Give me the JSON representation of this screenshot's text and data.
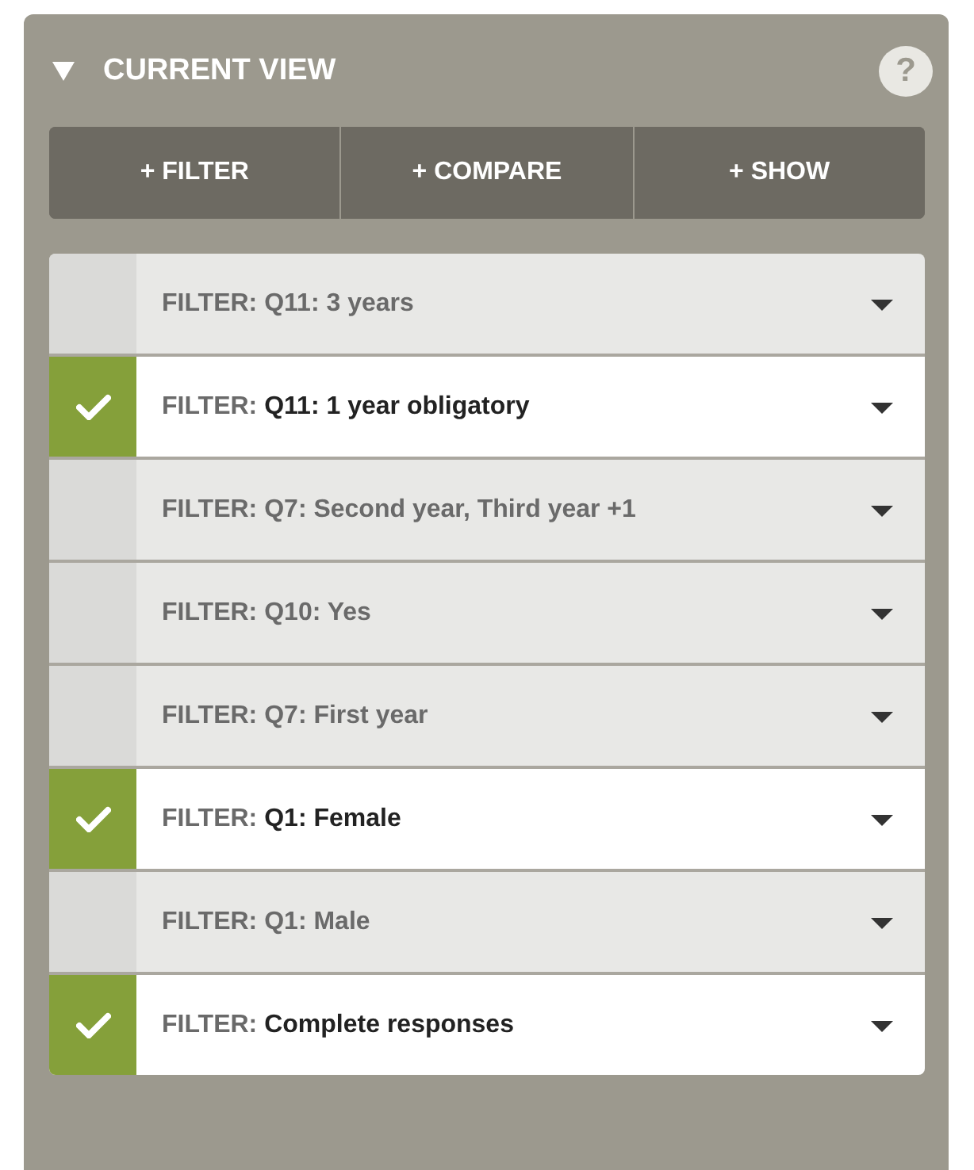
{
  "panel": {
    "title": "CURRENT VIEW",
    "expanded": true,
    "help": "?"
  },
  "actions": [
    "+ FILTER",
    "+ COMPARE",
    "+ SHOW"
  ],
  "filters": [
    {
      "prefix": "FILTER:",
      "text": "Q11: 3 years",
      "checked": false
    },
    {
      "prefix": "FILTER:",
      "text": "Q11: 1 year obligatory",
      "checked": true
    },
    {
      "prefix": "FILTER:",
      "text": "Q7: Second year, Third year +1",
      "checked": false
    },
    {
      "prefix": "FILTER:",
      "text": "Q10: Yes",
      "checked": false
    },
    {
      "prefix": "FILTER:",
      "text": "Q7: First year",
      "checked": false
    },
    {
      "prefix": "FILTER:",
      "text": "Q1: Female",
      "checked": true
    },
    {
      "prefix": "FILTER:",
      "text": "Q1: Male",
      "checked": false
    },
    {
      "prefix": "FILTER:",
      "text": "Complete responses",
      "checked": true
    }
  ]
}
